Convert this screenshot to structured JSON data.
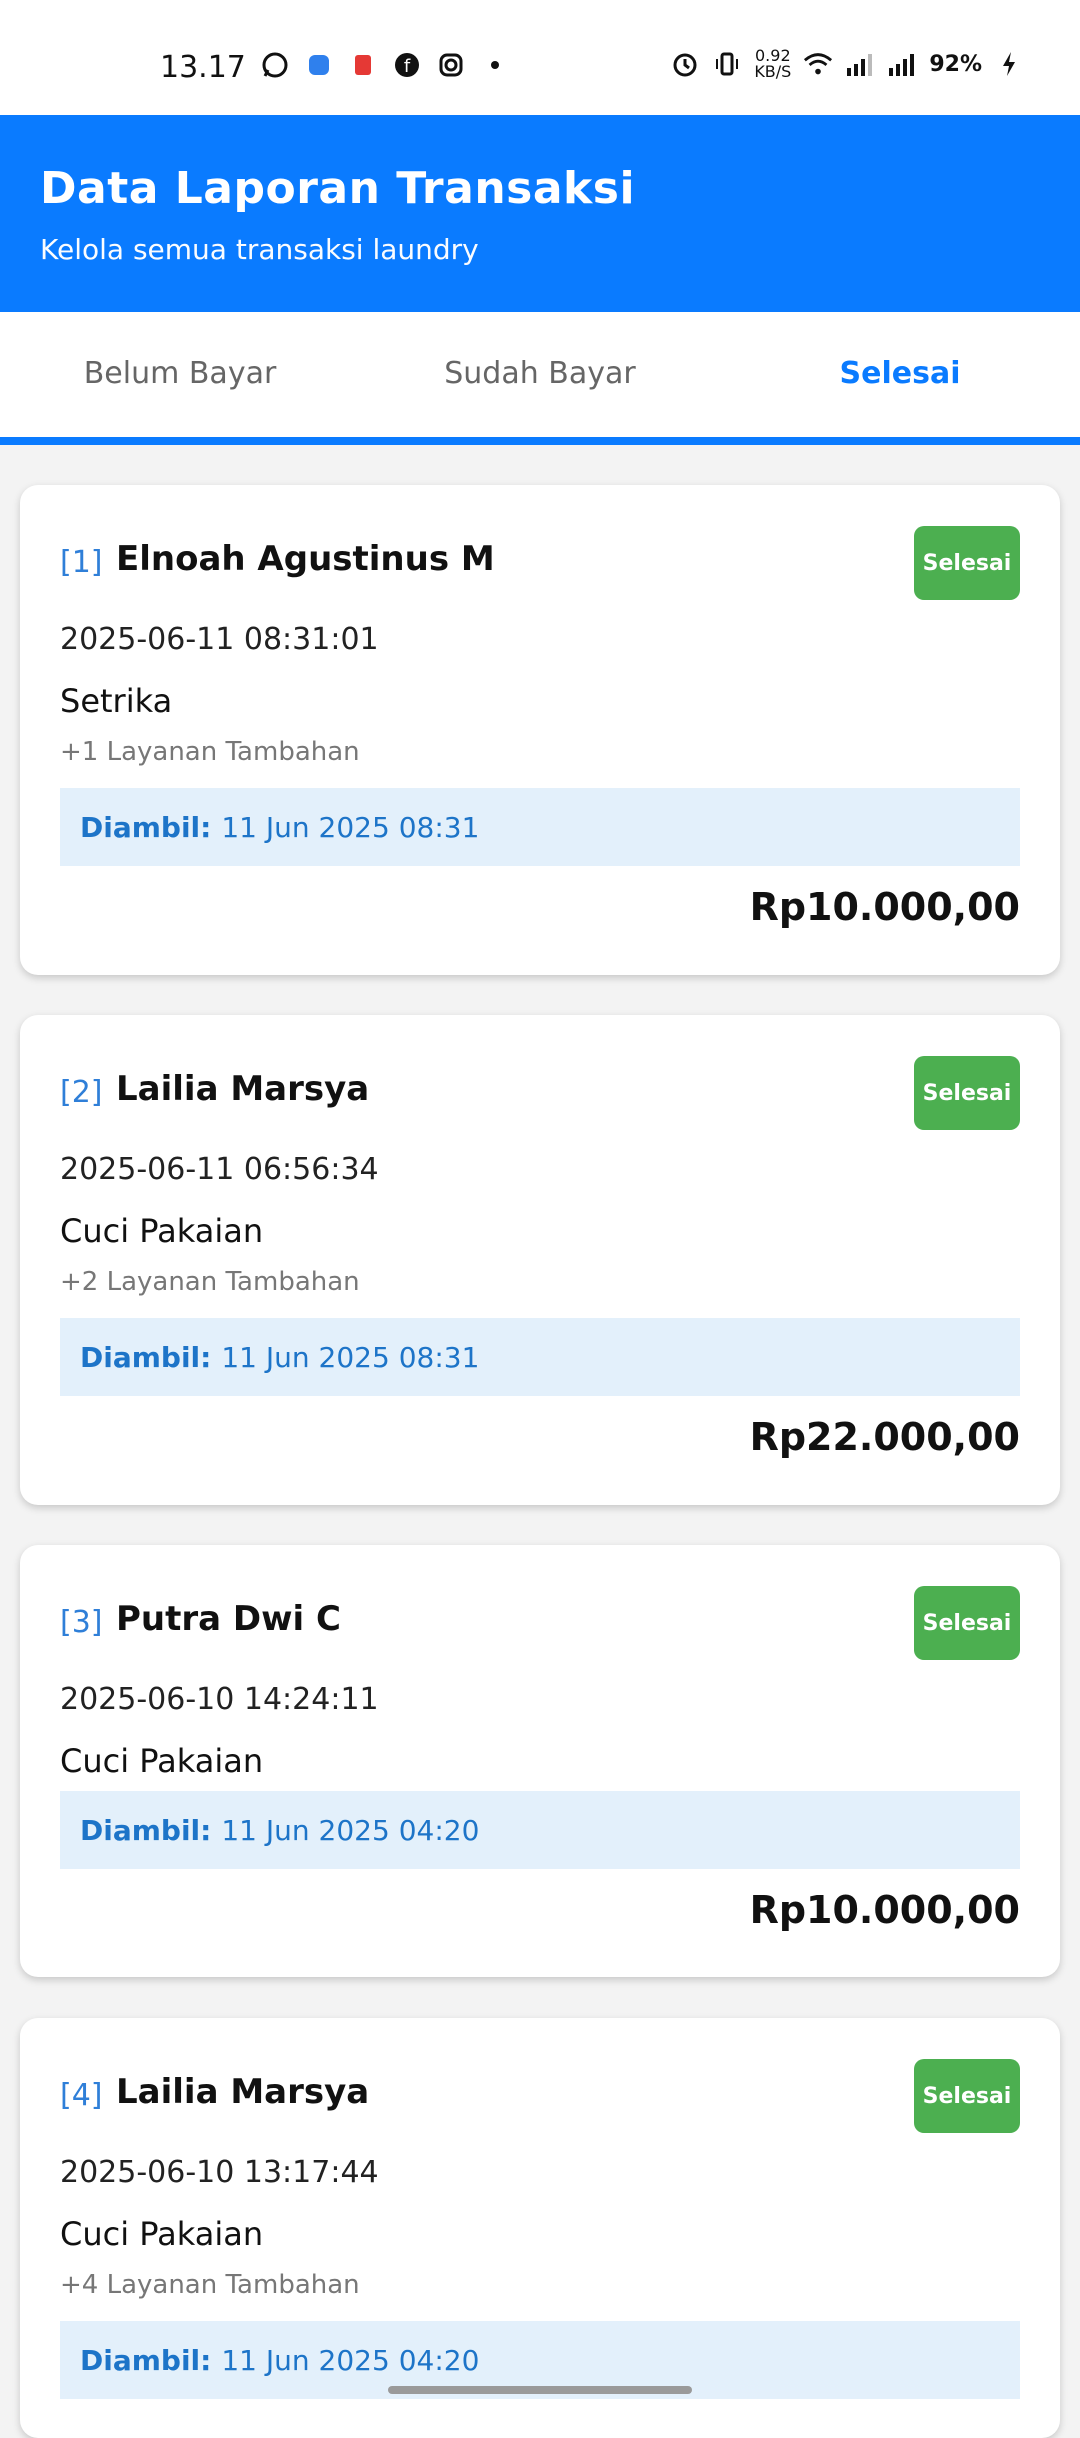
{
  "status_bar": {
    "time": "13.17",
    "net_speed_value": "0.92",
    "net_speed_unit": "KB/S",
    "battery": "92%",
    "icons": [
      "whatsapp-icon",
      "blue-app-icon",
      "red-app-icon",
      "facebook-icon",
      "instagram-icon",
      "dot-icon",
      "alarm-icon",
      "vibrate-icon",
      "wifi-icon",
      "signal-icon",
      "signal-icon",
      "charging-icon"
    ]
  },
  "header": {
    "title": "Data Laporan Transaksi",
    "subtitle": "Kelola semua transaksi laundry"
  },
  "tabs": [
    {
      "label": "Belum Bayar",
      "active": false
    },
    {
      "label": "Sudah Bayar",
      "active": false
    },
    {
      "label": "Selesai",
      "active": true
    }
  ],
  "cards": [
    {
      "index": "[1]",
      "name": "Elnoah Agustinus M",
      "status": "Selesai",
      "datetime": "2025-06-11 08:31:01",
      "service": "Setrika",
      "extra": "+1 Layanan Tambahan",
      "pickup_label": "Diambil:",
      "pickup_value": "11 Jun 2025 08:31",
      "amount": "Rp10.000,00"
    },
    {
      "index": "[2]",
      "name": "Lailia Marsya",
      "status": "Selesai",
      "datetime": "2025-06-11 06:56:34",
      "service": "Cuci Pakaian",
      "extra": "+2 Layanan Tambahan",
      "pickup_label": "Diambil:",
      "pickup_value": "11 Jun 2025 08:31",
      "amount": "Rp22.000,00"
    },
    {
      "index": "[3]",
      "name": "Putra Dwi C",
      "status": "Selesai",
      "datetime": "2025-06-10 14:24:11",
      "service": "Cuci Pakaian",
      "pickup_label": "Diambil:",
      "pickup_value": "11 Jun 2025 04:20",
      "amount": "Rp10.000,00"
    },
    {
      "index": "[4]",
      "name": "Lailia Marsya",
      "status": "Selesai",
      "datetime": "2025-06-10 13:17:44",
      "service": "Cuci Pakaian",
      "extra": "+4 Layanan Tambahan",
      "pickup_label": "Diambil:",
      "pickup_value": "11 Jun 2025 04:20"
    }
  ],
  "colors": {
    "primary": "#0a7bff",
    "badge": "#4caf50",
    "pickup_bg": "#e3f0fb",
    "pickup_text": "#1d74c8"
  }
}
